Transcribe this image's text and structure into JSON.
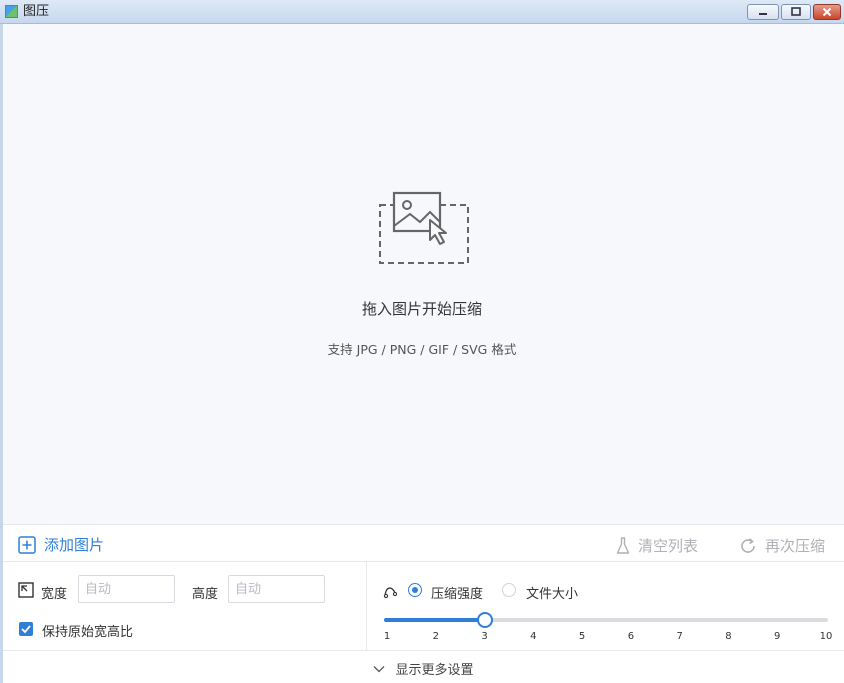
{
  "window": {
    "title": "图压",
    "controls": [
      "minimize",
      "maximize",
      "close"
    ]
  },
  "drop_zone": {
    "icon": "image-drop-icon",
    "title": "拖入图片开始压缩",
    "subtitle": "支持 JPG / PNG / GIF / SVG 格式"
  },
  "toolbar": {
    "add_label": "添加图片",
    "clear_label": "清空列表",
    "recompress_label": "再次压缩"
  },
  "size_settings": {
    "width_label": "宽度",
    "width_placeholder": "自动",
    "height_label": "高度",
    "height_placeholder": "自动",
    "keep_ratio_label": "保持原始宽高比",
    "keep_ratio_checked": true
  },
  "compress_settings": {
    "mode_strength_label": "压缩强度",
    "mode_filesize_label": "文件大小",
    "selected_mode": "压缩强度",
    "slider_value": 3,
    "slider_min": 1,
    "slider_max": 10,
    "ticks": [
      "1",
      "2",
      "3",
      "4",
      "5",
      "6",
      "7",
      "8",
      "9",
      "10"
    ]
  },
  "footer": {
    "more_label": "显示更多设置"
  },
  "colors": {
    "accent": "#2f7fd8",
    "disabled": "#aeb1b6",
    "background": "#f7f8fb"
  }
}
